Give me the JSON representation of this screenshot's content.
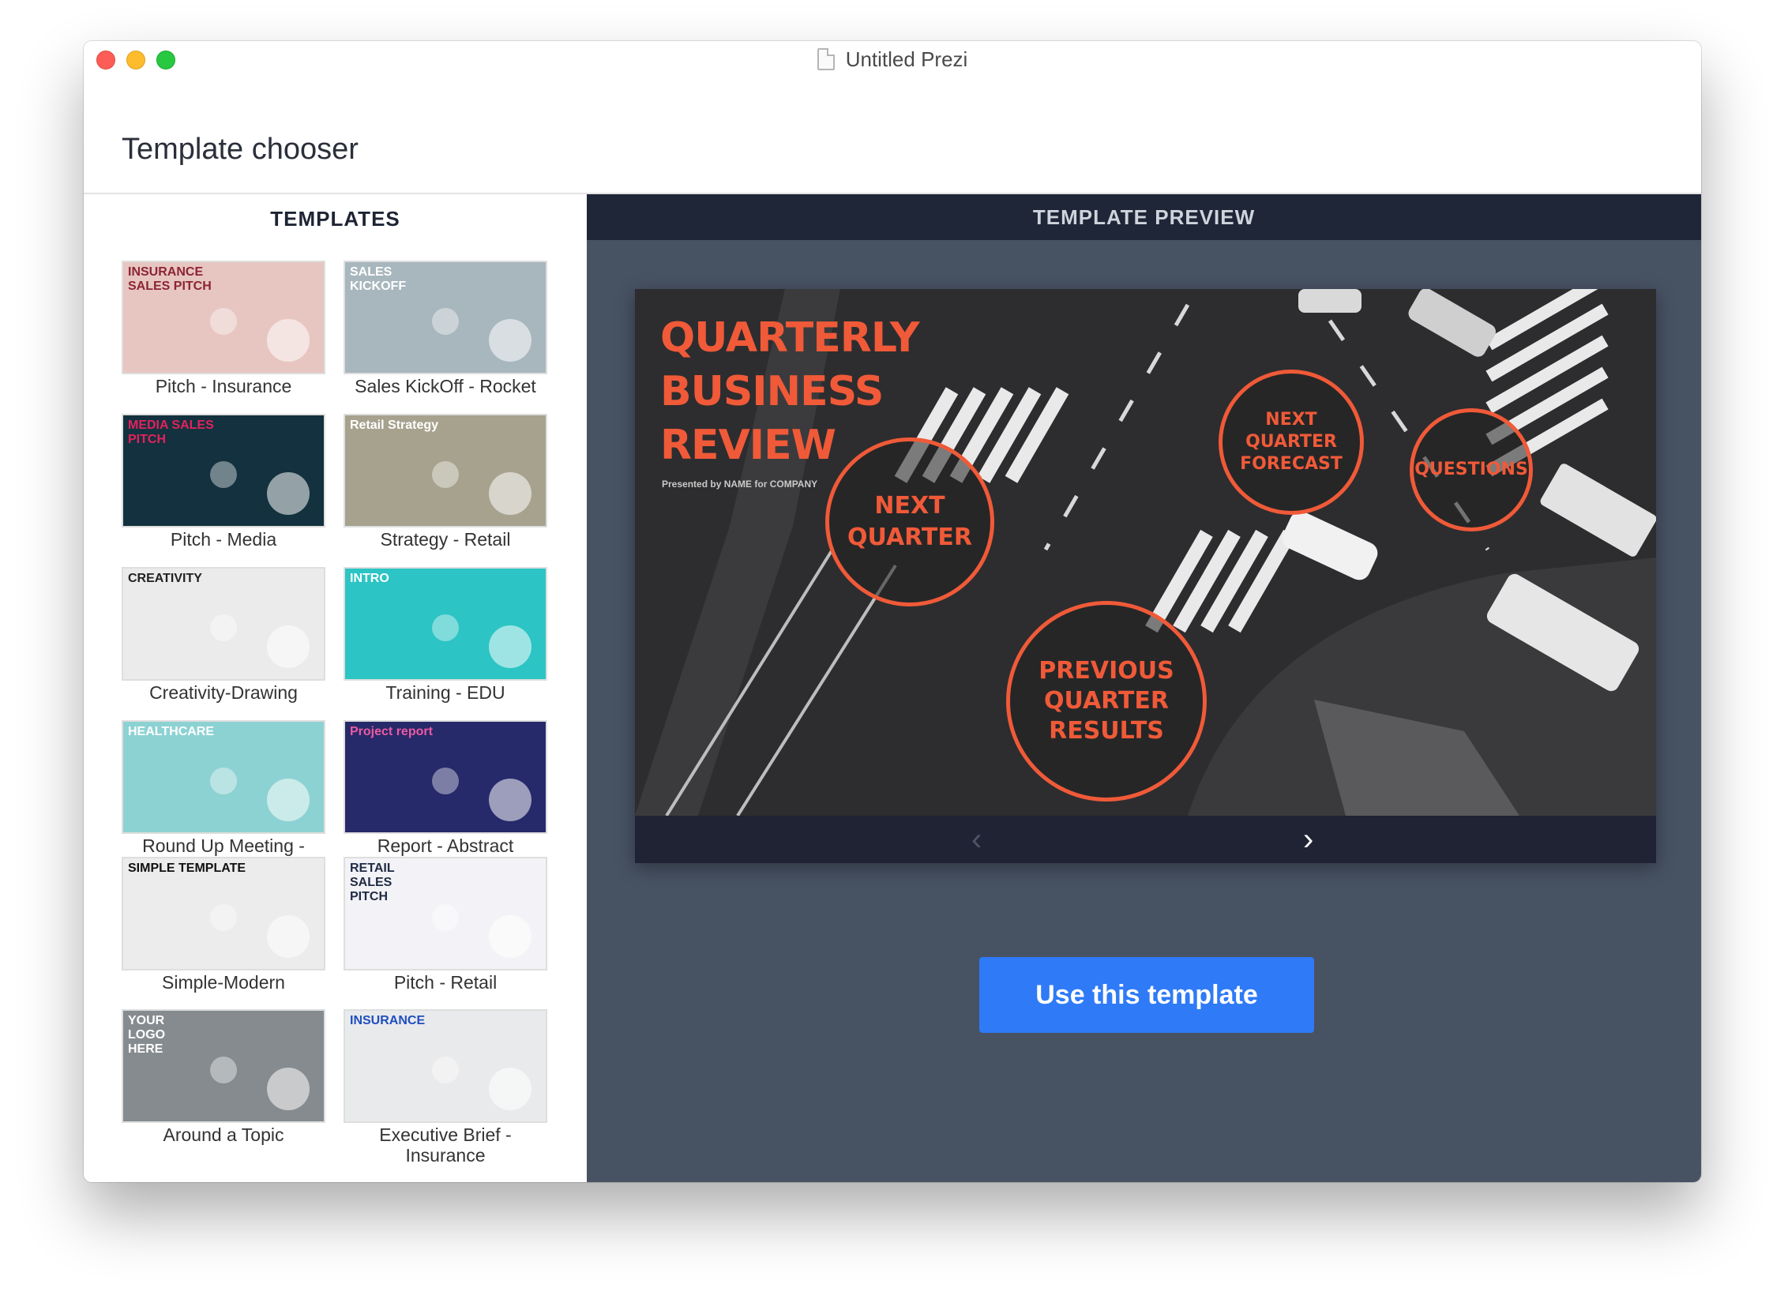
{
  "window": {
    "title": "Untitled Prezi"
  },
  "header": {
    "title": "Template chooser"
  },
  "templates": {
    "heading": "TEMPLATES",
    "items": [
      {
        "label": "Pitch - Insurance",
        "thumb_text": "INSURANCE\nSALES PITCH",
        "bg": "#e7c6c1",
        "fg": "#8c2435"
      },
      {
        "label": "Sales KickOff - Rocket",
        "thumb_text": "SALES\nKICKOFF",
        "bg": "#a8b6bd",
        "fg": "#ffffff"
      },
      {
        "label": "Pitch - Media",
        "thumb_text": "MEDIA SALES\nPITCH",
        "bg": "#13313e",
        "fg": "#e3225c"
      },
      {
        "label": "Strategy - Retail",
        "thumb_text": "Retail Strategy",
        "bg": "#a7a28e",
        "fg": "#ffffff"
      },
      {
        "label": "Creativity-Drawing",
        "thumb_text": "CREATIVITY",
        "bg": "#ebebeb",
        "fg": "#222222"
      },
      {
        "label": "Training - EDU",
        "thumb_text": "INTRO",
        "bg": "#2cc4c4",
        "fg": "#ffffff"
      },
      {
        "label": "Round Up Meeting -\nHealth",
        "thumb_text": "HEALTHCARE",
        "bg": "#8dd2d3",
        "fg": "#ffffff"
      },
      {
        "label": "Report - Abstract",
        "thumb_text": "Project report",
        "bg": "#26296a",
        "fg": "#ec5aa0"
      },
      {
        "label": "Simple-Modern",
        "thumb_text": "SIMPLE TEMPLATE",
        "bg": "#ececec",
        "fg": "#111111"
      },
      {
        "label": "Pitch - Retail",
        "thumb_text": "RETAIL\nSALES\nPITCH",
        "bg": "#f3f3f7",
        "fg": "#1f2a44"
      },
      {
        "label": "Around a Topic",
        "thumb_text": "YOUR\nLOGO\nHERE",
        "bg": "#858b8e",
        "fg": "#ffffff"
      },
      {
        "label": "Executive Brief -\nInsurance",
        "thumb_text": "INSURANCE",
        "bg": "#e9eaec",
        "fg": "#1f4fbf"
      }
    ]
  },
  "preview": {
    "heading": "TEMPLATE PREVIEW",
    "slide": {
      "title": "QUARTERLY\nBUSINESS\nREVIEW",
      "subtitle": "Presented by NAME for COMPANY",
      "topics": [
        "NEXT\nQUARTER",
        "PREVIOUS\nQUARTER\nRESULTS",
        "NEXT\nQUARTER\nFORECAST",
        "QUESTIONS"
      ]
    },
    "nav": {
      "prev": "‹",
      "next": "›"
    },
    "use_button": "Use this template"
  },
  "colors": {
    "accent": "#2f7af7",
    "slide_orange": "#f05a38",
    "panel_dark": "#1e2638",
    "panel_bg": "#475263"
  }
}
